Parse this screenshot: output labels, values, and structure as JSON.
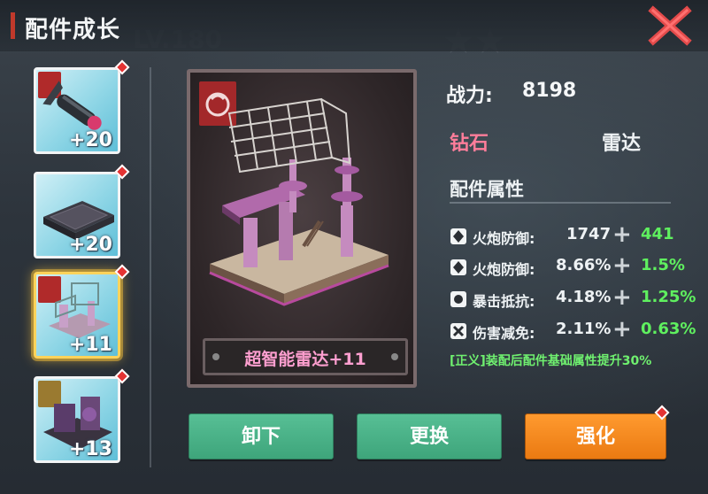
{
  "header": {
    "title": "配件成长"
  },
  "slots": [
    {
      "level": "+20",
      "icon": "torpedo-icon",
      "selected": false
    },
    {
      "level": "+20",
      "icon": "armor-plate-icon",
      "selected": false
    },
    {
      "level": "+11",
      "icon": "radar-tower-icon",
      "selected": true
    },
    {
      "level": "+13",
      "icon": "machinery-icon",
      "selected": false
    }
  ],
  "preview": {
    "name": "超智能雷达+11"
  },
  "stats": {
    "power_label": "战力:",
    "power_value": "8198",
    "quality": "钻石",
    "part_type": "雷达",
    "attr_title": "配件属性",
    "attrs": [
      {
        "name": "火炮防御:",
        "value": "1747",
        "bonus": "441"
      },
      {
        "name": "火炮防御:",
        "value": "8.66%",
        "bonus": "1.5%"
      },
      {
        "name": "暴击抵抗:",
        "value": "4.18%",
        "bonus": "1.25%"
      },
      {
        "name": "伤害减免:",
        "value": "2.11%",
        "bonus": "0.63%"
      }
    ],
    "note": "[正义]装配后配件基础属性提升30%"
  },
  "buttons": {
    "unequip": "卸下",
    "replace": "更换",
    "upgrade": "强化"
  },
  "colors": {
    "accent_red": "#c0392b",
    "bonus_green": "#5ff05f",
    "button_green": "#3ea57b",
    "button_orange": "#ea7a12",
    "quality_pink": "#ff7d9a"
  }
}
